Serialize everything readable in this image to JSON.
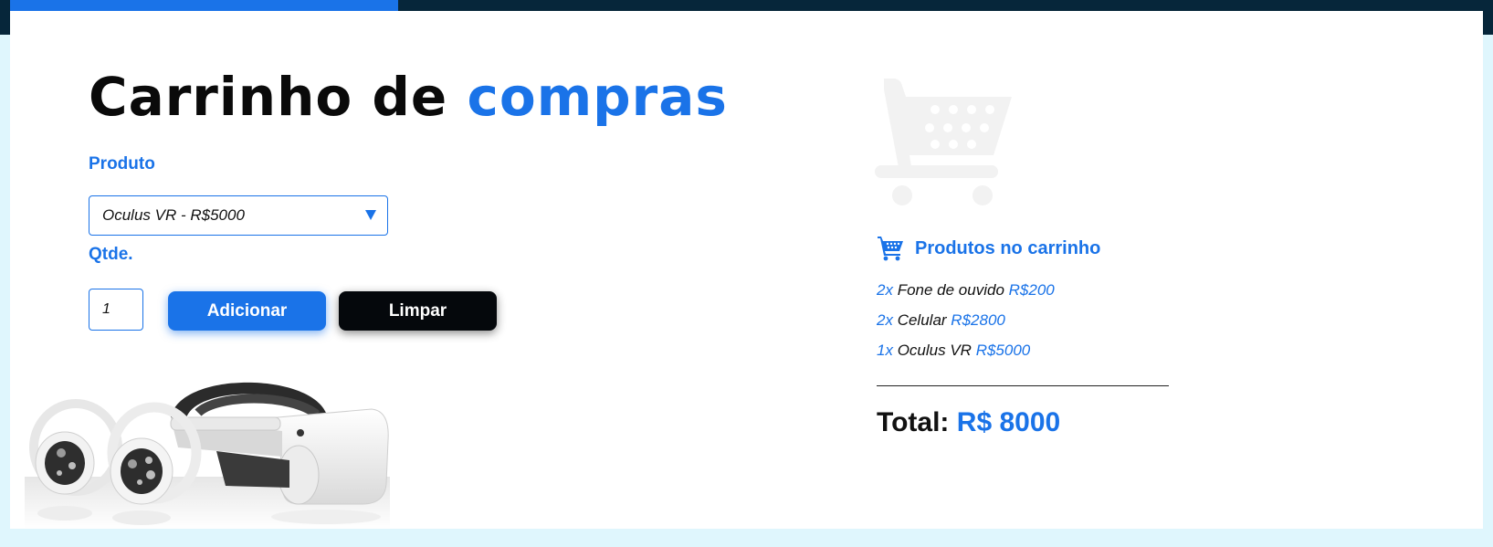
{
  "page": {
    "title_part1": "Carrinho de",
    "title_part2": "compras"
  },
  "form": {
    "product_label": "Produto",
    "product_selected": "Oculus VR - R$5000",
    "qty_label": "Qtde.",
    "qty_value": "1",
    "add_button_label": "Adicionar",
    "clear_button_label": "Limpar"
  },
  "cart": {
    "header_label": "Produtos no carrinho",
    "items": [
      {
        "qty": "2x",
        "name": "Fone de ouvido",
        "price": "R$200"
      },
      {
        "qty": "2x",
        "name": "Celular",
        "price": "R$2800"
      },
      {
        "qty": "1x",
        "name": "Oculus VR",
        "price": "R$5000"
      }
    ],
    "total_label": "Total:",
    "total_value": "R$ 8000"
  },
  "icons": {
    "cart_header_icon": "shopping-cart-icon",
    "background_cart_icon": "large-cart-icon",
    "select_caret": "caret-down-icon"
  },
  "colors": {
    "accent": "#1a73e8",
    "dark": "#05080c",
    "top_band": "#06263a",
    "outer_background": "#dff6fd"
  }
}
